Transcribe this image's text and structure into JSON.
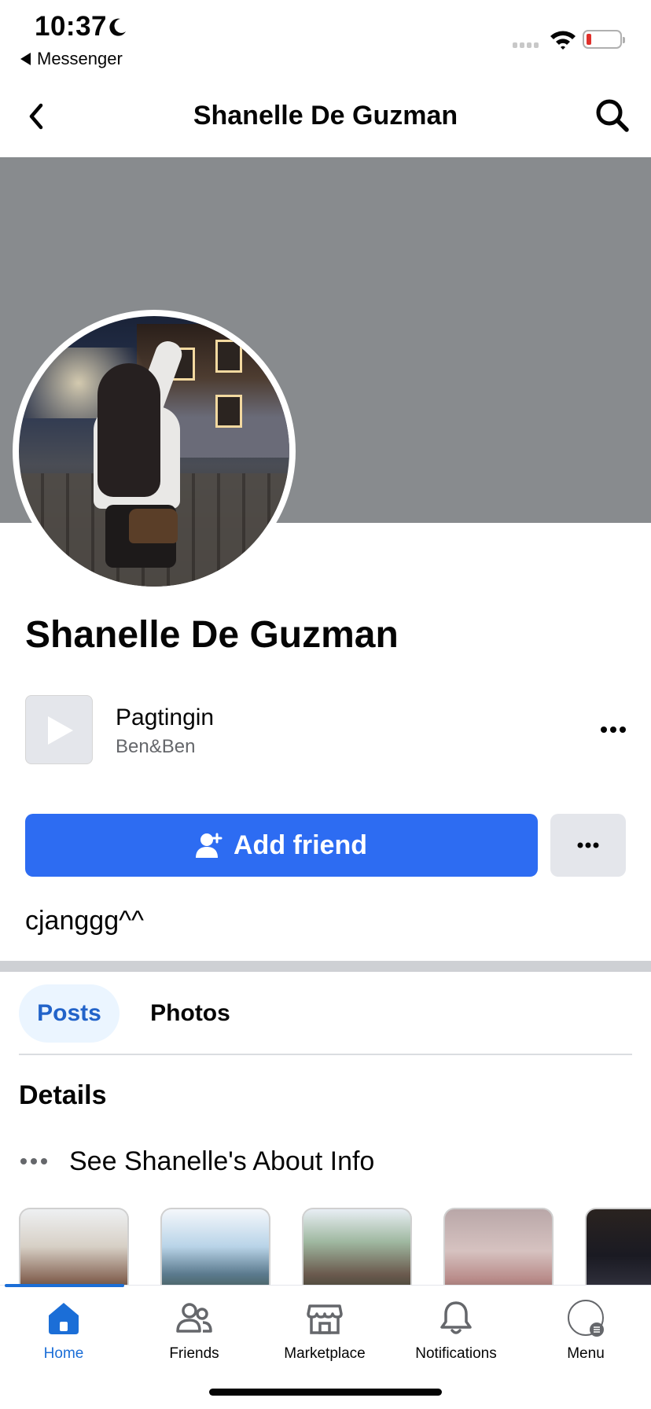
{
  "status_bar": {
    "time": "10:37",
    "back_app": "Messenger"
  },
  "header": {
    "title": "Shanelle De Guzman"
  },
  "profile": {
    "name": "Shanelle De Guzman",
    "music": {
      "title": "Pagtingin",
      "artist": "Ben&Ben"
    },
    "add_friend_label": "Add friend",
    "bio": "cjanggg^^"
  },
  "tabs": [
    {
      "label": "Posts",
      "active": true
    },
    {
      "label": "Photos",
      "active": false
    }
  ],
  "details": {
    "heading": "Details",
    "about_link": "See Shanelle's About Info"
  },
  "bottom_nav": [
    {
      "label": "Home",
      "icon": "home-icon",
      "active": true
    },
    {
      "label": "Friends",
      "icon": "friends-icon",
      "active": false
    },
    {
      "label": "Marketplace",
      "icon": "marketplace-icon",
      "active": false
    },
    {
      "label": "Notifications",
      "icon": "bell-icon",
      "active": false
    },
    {
      "label": "Menu",
      "icon": "menu-avatar-icon",
      "active": false
    }
  ],
  "colors": {
    "accent": "#1b6ed7",
    "button_primary": "#2d6cf2",
    "cover": "#888b8e"
  }
}
